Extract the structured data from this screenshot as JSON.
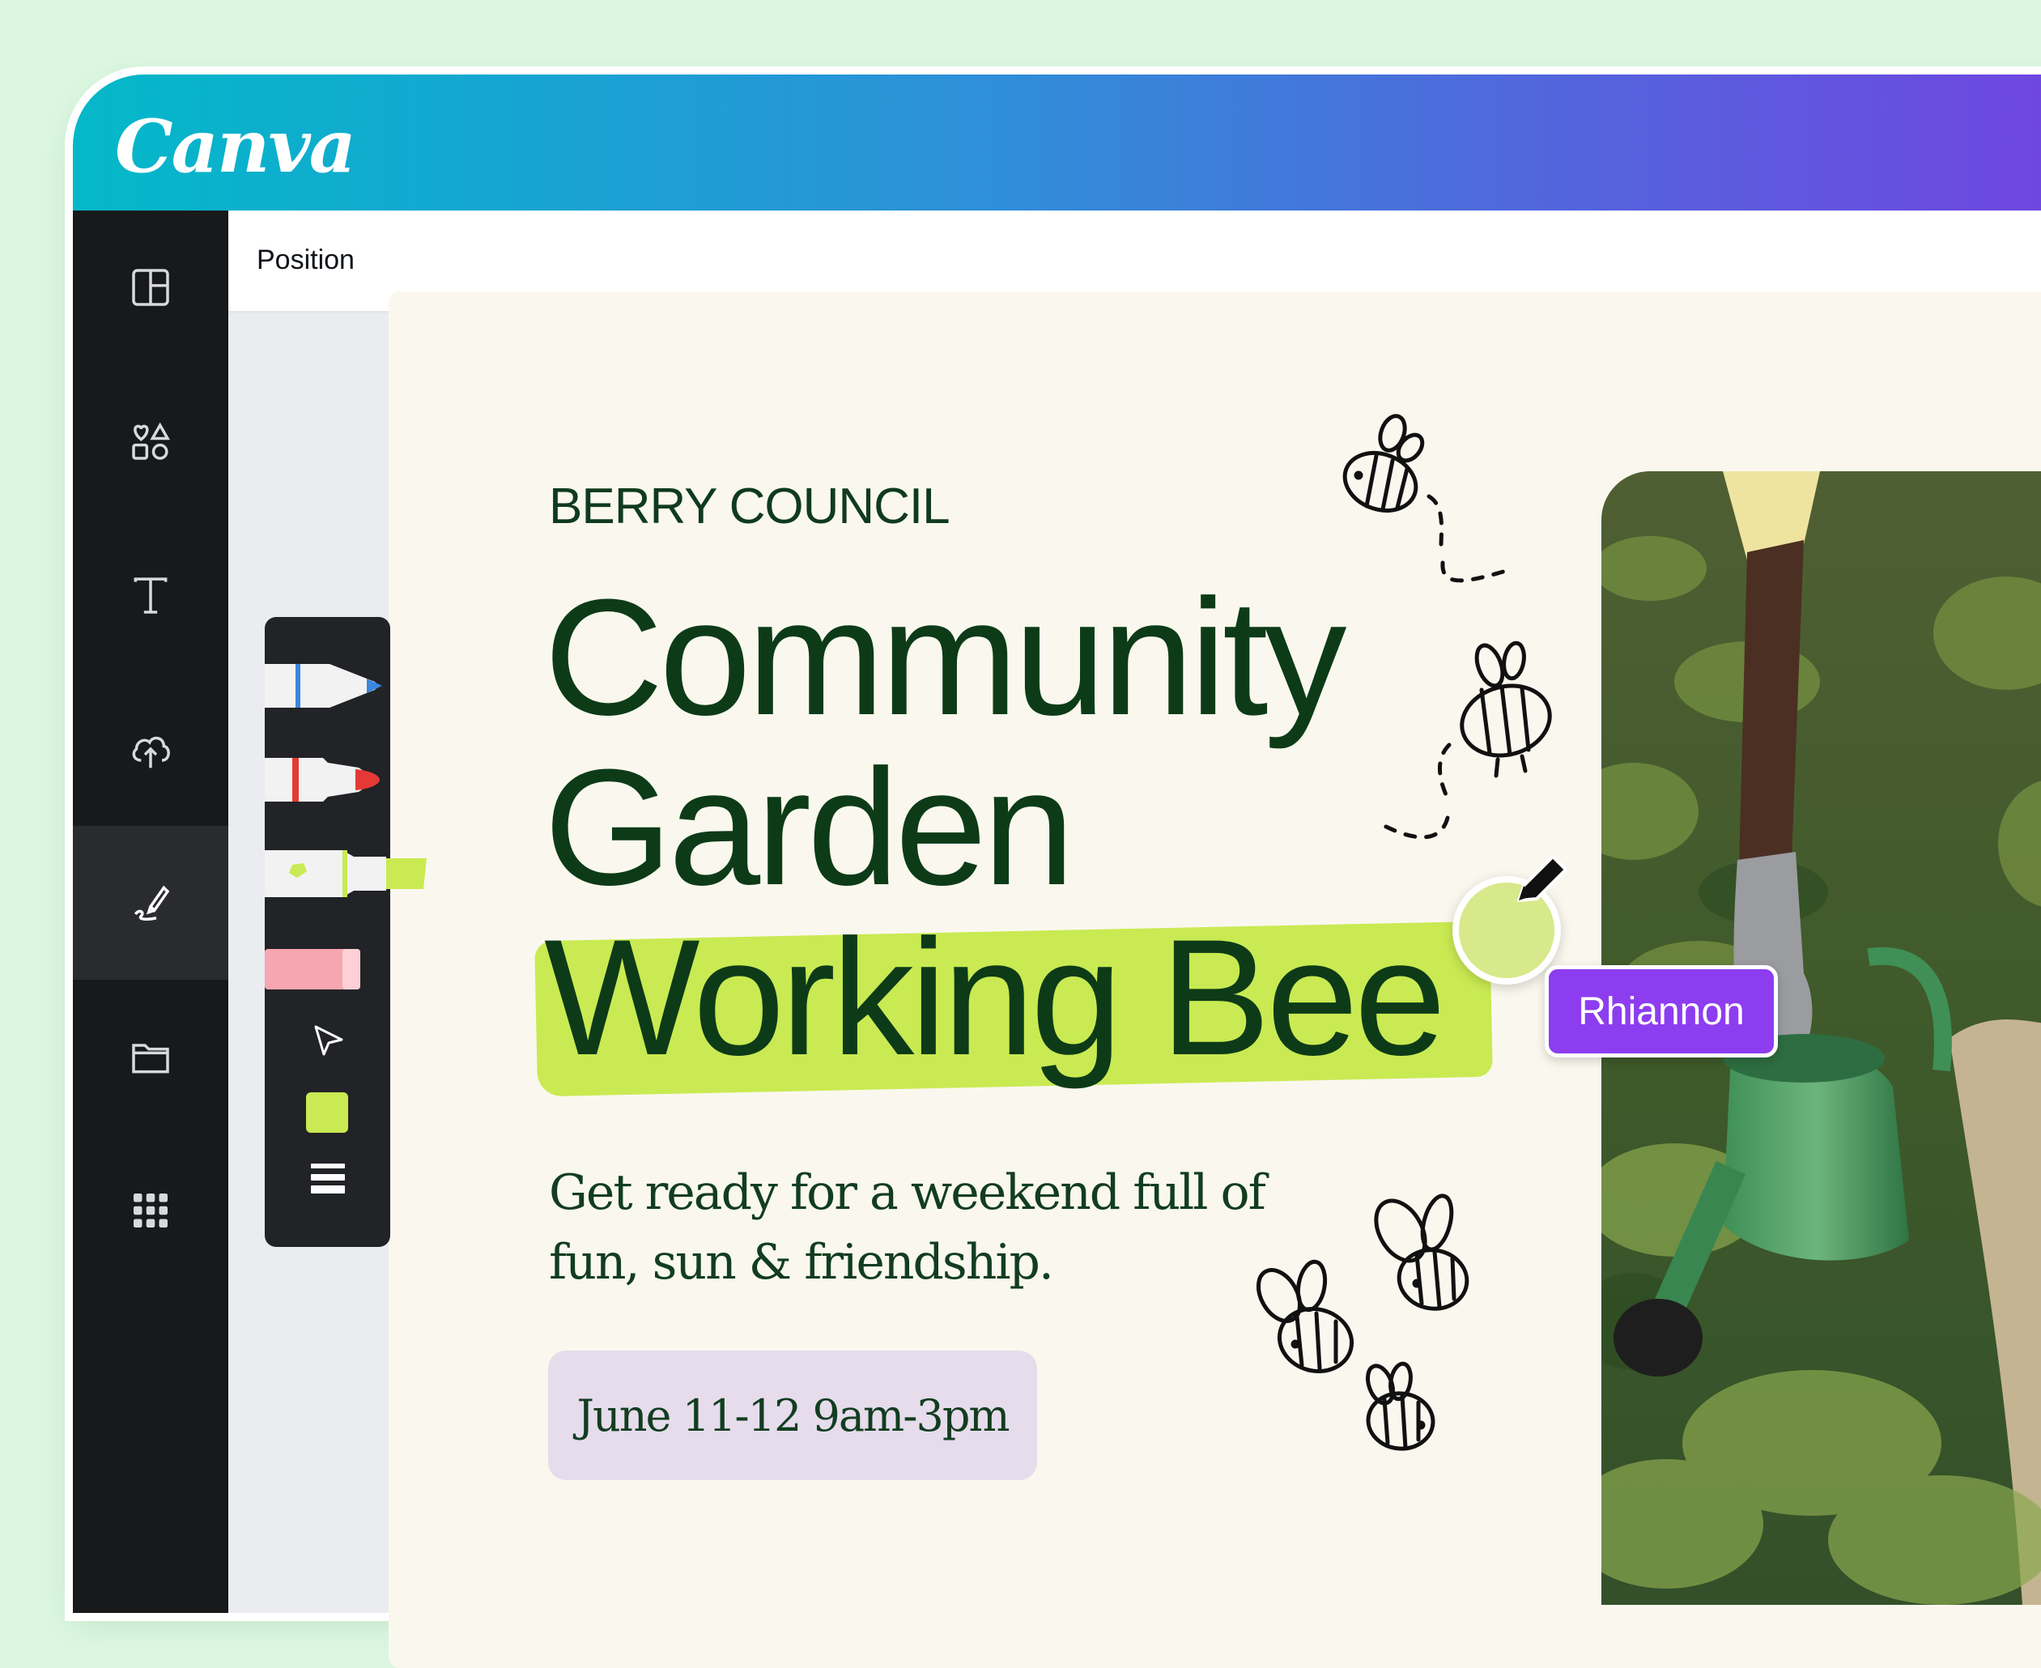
{
  "app": {
    "logo_text": "Canva"
  },
  "colors": {
    "brand_gradient": [
      "#04b8c8",
      "#7342e2"
    ],
    "sidebar_bg": "#18191b",
    "highlight": "#c9ea52",
    "headline_text": "#0d3b18",
    "date_pill_bg": "#e6dcec",
    "collaborator_tag": "#8d3df0"
  },
  "sidebar": {
    "items": [
      {
        "icon": "layout-icon"
      },
      {
        "icon": "elements-icon"
      },
      {
        "icon": "text-icon"
      },
      {
        "icon": "upload-cloud-icon"
      },
      {
        "icon": "draw-icon",
        "active": true
      },
      {
        "icon": "folder-icon"
      },
      {
        "icon": "apps-grid-icon"
      }
    ]
  },
  "toolbar": {
    "label": "Position"
  },
  "draw_tools": {
    "tools": [
      "blue-pen",
      "red-marker",
      "green-highlighter",
      "pink-eraser",
      "select-arrow"
    ],
    "selected_color": "#c9ea52"
  },
  "poster": {
    "organization": "BERRY COUNCIL",
    "headline": [
      "Community",
      "Garden",
      "Working Bee"
    ],
    "subtext_lines": [
      "Get ready for a weekend full of",
      "fun, sun & friendship."
    ],
    "date": "June 11-12 9am-3pm"
  },
  "collaborator": {
    "name": "Rhiannon"
  }
}
